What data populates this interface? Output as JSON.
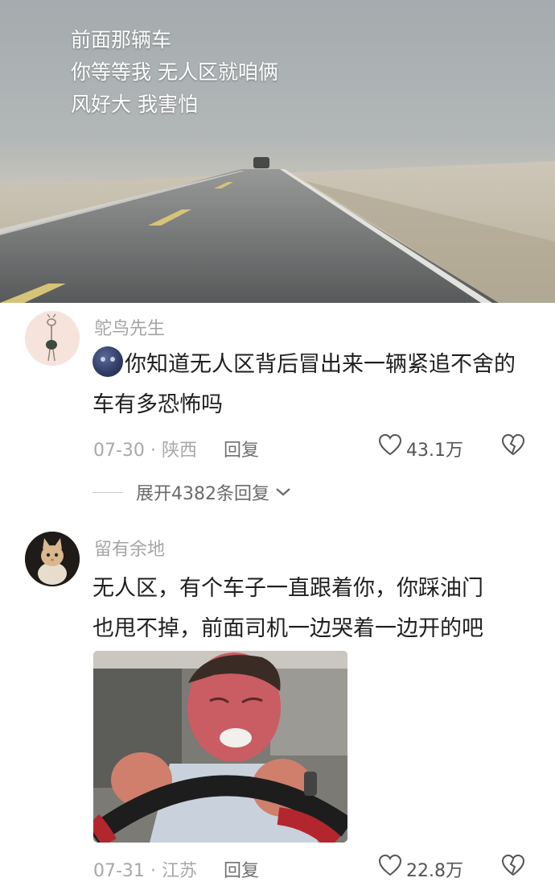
{
  "video": {
    "caption_lines": [
      "前面那辆车",
      "你等等我 无人区就咱俩",
      "风好大 我害怕"
    ]
  },
  "comments": [
    {
      "username": "鸵鸟先生",
      "avatar_icon": "ostrich-sketch-avatar",
      "emoji_icon": "dark-moon-face-emoji",
      "text": "你知道无人区背后冒出来一辆紧追不舍的车有多恐怖吗",
      "date": "07-30",
      "location": "陕西",
      "reply_label": "回复",
      "likes": "43.1万",
      "replies_expand": "展开4382条回复"
    },
    {
      "username": "留有余地",
      "avatar_icon": "kitten-avatar",
      "text_line1": "无人区，有个车子一直跟着你，你踩油门",
      "text_line2": "也甩不掉，前面司机一边哭着一边开的吧",
      "image": "crying-driver-meme",
      "date": "07-31",
      "location": "江苏",
      "reply_label": "回复",
      "likes": "22.8万"
    }
  ],
  "colors": {
    "username": "#a5a5a5",
    "body_text": "#1f1f1f",
    "meta": "#a8a8a8"
  }
}
